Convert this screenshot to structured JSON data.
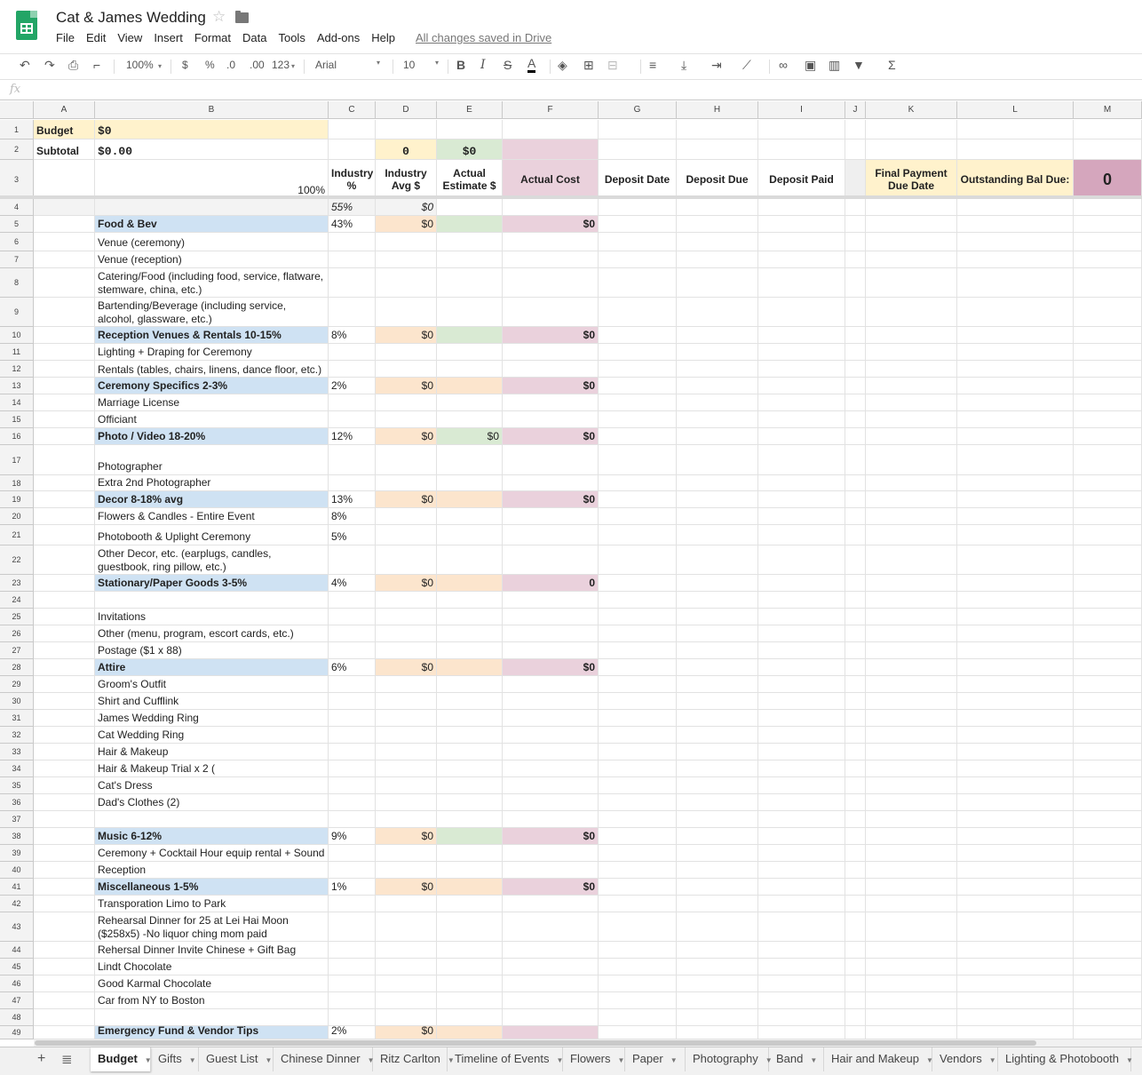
{
  "doc": {
    "title": "Cat & James Wedding",
    "menu": [
      "File",
      "Edit",
      "View",
      "Insert",
      "Format",
      "Data",
      "Tools",
      "Add-ons",
      "Help"
    ],
    "saved_status": "All changes saved in Drive"
  },
  "toolbar": {
    "zoom": "100%",
    "currency": "$",
    "percent": "%",
    "dec_less": ".0",
    "dec_more": ".00",
    "more_formats": "123",
    "font": "Arial",
    "font_size": "10",
    "bold": "B",
    "italic": "I",
    "strike": "S",
    "text_color": "A"
  },
  "formula_bar": {
    "fx": "fx"
  },
  "columns": [
    "A",
    "B",
    "C",
    "D",
    "E",
    "F",
    "G",
    "H",
    "I",
    "J",
    "K",
    "L",
    "M"
  ],
  "header_cells": {
    "a1": "Budget",
    "b1": "$0",
    "a2": "Subtotal",
    "b2": "$0.00",
    "d2": "0",
    "e2": "$0",
    "b3": "100%",
    "c3": "Industry %",
    "d3": "Industry Avg $",
    "e3": "Actual Estimate $",
    "f3": "Actual Cost",
    "g3": "Deposit Date",
    "h3": "Deposit Due",
    "i3": "Deposit Paid",
    "k3": "Final Payment Due Date",
    "l3": "Outstanding Bal Due:",
    "m3": "0",
    "c4": "55%",
    "d4": "$0"
  },
  "rows": [
    {
      "n": "5",
      "b": "Food & Bev",
      "cat": true,
      "c": "43%",
      "d": "$0",
      "e": "",
      "f": "$0",
      "eclr": "green"
    },
    {
      "n": "6",
      "b": "Venue (ceremony)"
    },
    {
      "n": "7",
      "b": "Venue (reception)"
    },
    {
      "n": "8",
      "b": "Catering/Food (including food, service, flatware, stemware, china, etc.)"
    },
    {
      "n": "9",
      "b": "Bartending/Beverage (including service, alcohol, glassware, etc.)"
    },
    {
      "n": "10",
      "b": "Reception Venues & Rentals 10-15%",
      "cat": true,
      "c": "8%",
      "d": "$0",
      "e": "",
      "f": "$0",
      "eclr": "green"
    },
    {
      "n": "11",
      "b": "Lighting + Draping for Ceremony"
    },
    {
      "n": "12",
      "b": "Rentals (tables, chairs, linens, dance floor, etc.)"
    },
    {
      "n": "13",
      "b": "Ceremony Specifics 2-3%",
      "cat": true,
      "c": "2%",
      "d": "$0",
      "e": "",
      "f": "$0",
      "eclr": "peach"
    },
    {
      "n": "14",
      "b": "Marriage License"
    },
    {
      "n": "15",
      "b": "Officiant"
    },
    {
      "n": "16",
      "b": "Photo / Video 18-20%",
      "cat": true,
      "c": "12%",
      "d": "$0",
      "e": "$0",
      "f": "$0",
      "eclr": "green"
    },
    {
      "n": "17",
      "b": "Photographer"
    },
    {
      "n": "18",
      "b": "Extra 2nd Photographer"
    },
    {
      "n": "19",
      "b": "Decor 8-18% avg",
      "cat": true,
      "c": "13%",
      "d": "$0",
      "e": "",
      "f": "$0",
      "eclr": "peach"
    },
    {
      "n": "20",
      "b": "Flowers & Candles - Entire Event",
      "c": "8%"
    },
    {
      "n": "21",
      "b": "Photobooth & Uplight Ceremony",
      "c": "5%"
    },
    {
      "n": "22",
      "b": "Other Decor, etc. (earplugs, candles, guestbook, ring pillow, etc.)"
    },
    {
      "n": "23",
      "b": "Stationary/Paper Goods 3-5%",
      "cat": true,
      "c": "4%",
      "d": "$0",
      "e": "",
      "f": "0",
      "eclr": "peach"
    },
    {
      "n": "24",
      "b": ""
    },
    {
      "n": "25",
      "b": "Invitations"
    },
    {
      "n": "26",
      "b": "Other (menu, program, escort cards, etc.)"
    },
    {
      "n": "27",
      "b": "Postage ($1 x 88)"
    },
    {
      "n": "28",
      "b": "Attire",
      "cat": true,
      "c": "6%",
      "d": "$0",
      "e": "",
      "f": "$0",
      "eclr": "peach"
    },
    {
      "n": "29",
      "b": "Groom's Outfit"
    },
    {
      "n": "30",
      "b": "Shirt and Cufflink"
    },
    {
      "n": "31",
      "b": "James Wedding Ring"
    },
    {
      "n": "32",
      "b": "Cat Wedding Ring"
    },
    {
      "n": "33",
      "b": "Hair & Makeup"
    },
    {
      "n": "34",
      "b": "Hair & Makeup Trial x 2 ("
    },
    {
      "n": "35",
      "b": "Cat's Dress"
    },
    {
      "n": "36",
      "b": "Dad's Clothes (2)"
    },
    {
      "n": "37",
      "b": ""
    },
    {
      "n": "38",
      "b": "Music 6-12%",
      "cat": true,
      "c": "9%",
      "d": "$0",
      "e": "",
      "f": "$0",
      "eclr": "green"
    },
    {
      "n": "39",
      "b": "Ceremony + Cocktail Hour equip rental + Sound"
    },
    {
      "n": "40",
      "b": "Reception"
    },
    {
      "n": "41",
      "b": "Miscellaneous 1-5%",
      "cat": true,
      "c": "1%",
      "d": "$0",
      "e": "",
      "f": "$0",
      "eclr": "peach"
    },
    {
      "n": "42",
      "b": "Transporation Limo to Park"
    },
    {
      "n": "43",
      "b": "Rehearsal Dinner for 25 at Lei Hai Moon ($258x5) -No liquor  ching mom paid"
    },
    {
      "n": "44",
      "b": "Rehersal Dinner Invite Chinese + Gift Bag"
    },
    {
      "n": "45",
      "b": "Lindt Chocolate"
    },
    {
      "n": "46",
      "b": "Good Karmal Chocolate"
    },
    {
      "n": "47",
      "b": "Car from NY to Boston"
    },
    {
      "n": "48",
      "b": ""
    },
    {
      "n": "49",
      "b": "Emergency Fund & Vendor Tips",
      "cat": true,
      "c": "2%",
      "d": "$0",
      "e": "",
      "f": "",
      "eclr": "peach"
    }
  ],
  "sheet_tabs": [
    "Budget",
    "Gifts",
    "Guest List",
    "Chinese Dinner",
    "Ritz Carlton",
    "Timeline of Events",
    "Flowers",
    "Paper",
    "Photography",
    "Band",
    "Hair and Makeup",
    "Vendors",
    "Lighting & Photobooth"
  ],
  "colors": {
    "category_blue": "#cfe2f3",
    "peach": "#fce5cd",
    "green": "#d9ead3",
    "pink": "#ead1dc",
    "m3_pink": "#d5a6bd",
    "budget_yellow": "#fff2cc",
    "sheets_green": "#23a566"
  }
}
